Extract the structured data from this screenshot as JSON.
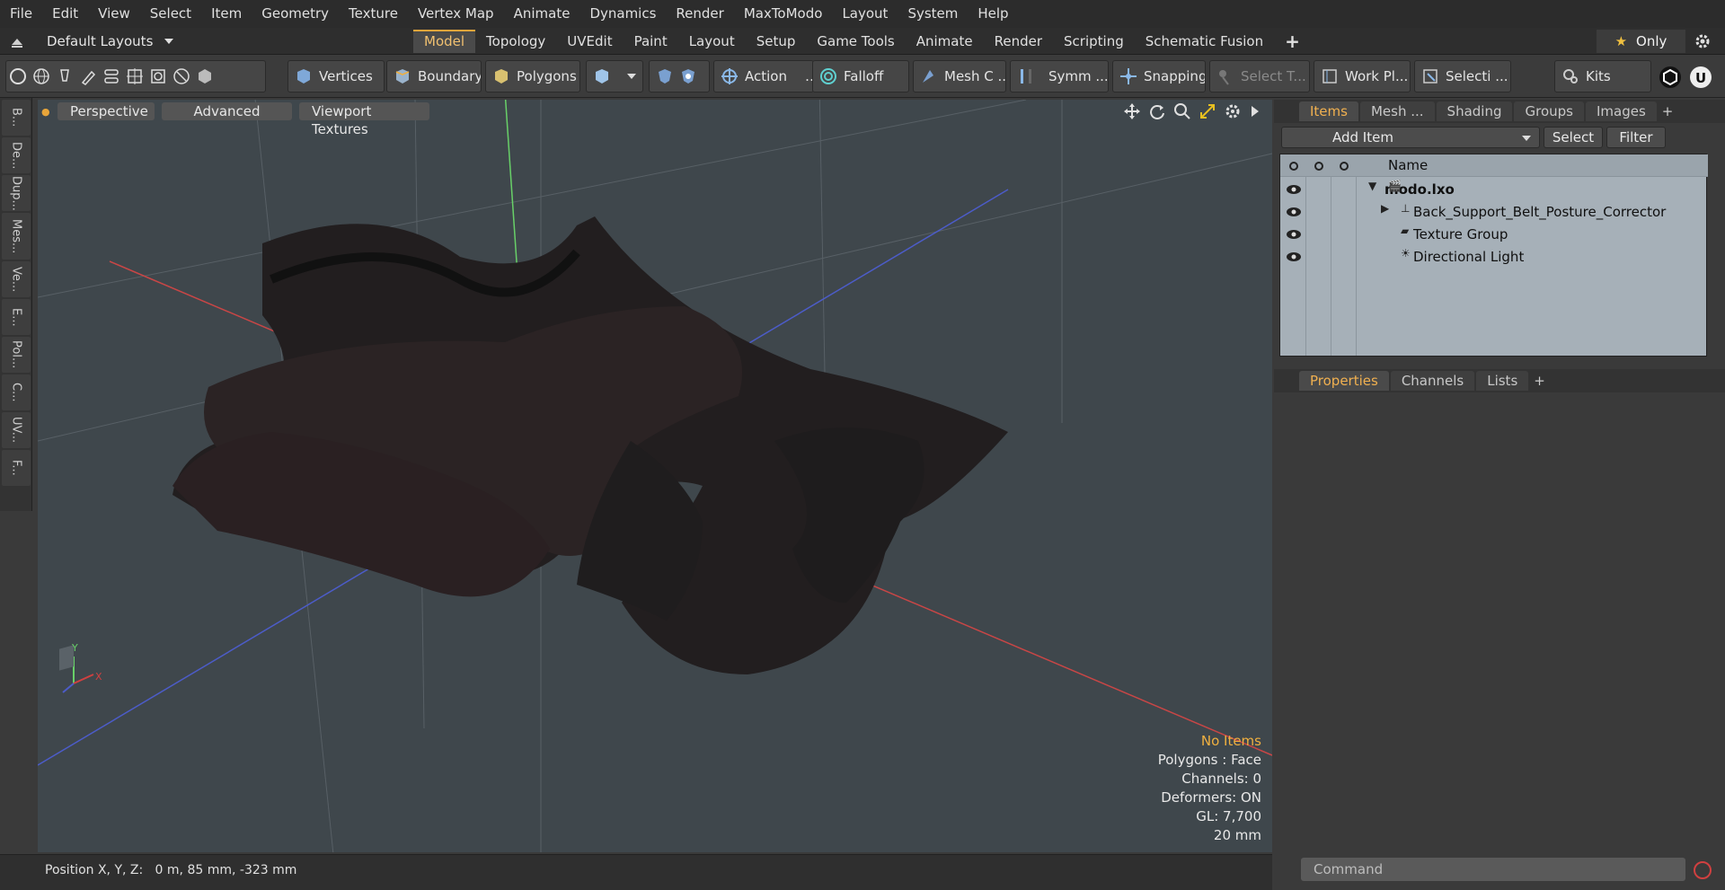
{
  "menu": [
    "File",
    "Edit",
    "View",
    "Select",
    "Item",
    "Geometry",
    "Texture",
    "Vertex Map",
    "Animate",
    "Dynamics",
    "Render",
    "MaxToModo",
    "Layout",
    "System",
    "Help"
  ],
  "layouts": {
    "label": "Default Layouts"
  },
  "tabs": [
    "Model",
    "Topology",
    "UVEdit",
    "Paint",
    "Layout",
    "Setup",
    "Game Tools",
    "Animate",
    "Render",
    "Scripting",
    "Schematic Fusion"
  ],
  "active_tab": "Model",
  "only": "Only",
  "toolbar": {
    "vertices": "Vertices",
    "boundary": "Boundary",
    "polygons": "Polygons",
    "action": "Action",
    "action_more": "…",
    "falloff": "Falloff",
    "mesh": "Mesh C ...",
    "symm": "Symm ...",
    "snapping": "Snapping",
    "select_t": "Select T...",
    "workplane": "Work Pl...",
    "selection": "Selecti ...",
    "kits": "Kits"
  },
  "left_tabs": [
    "B...",
    "De...",
    "Dup...",
    "Mes...",
    "Ve...",
    "E...",
    "Pol...",
    "C...",
    "UV...",
    "F..."
  ],
  "viewport": {
    "tabs": [
      "Perspective",
      "Advanced",
      "Viewport Textures"
    ],
    "info": {
      "no_items": "No Items",
      "polygons": "Polygons : Face",
      "channels": "Channels: 0",
      "deformers": "Deformers: ON",
      "gl": "GL: 7,700",
      "scale": "20 mm"
    },
    "axis": {
      "y": "Y",
      "x": "X"
    }
  },
  "status": {
    "position": "Position X, Y, Z:   0 m, 85 mm, -323 mm"
  },
  "items_panel": {
    "tabs": [
      "Items",
      "Mesh ...",
      "Shading",
      "Groups",
      "Images"
    ],
    "add_item": "Add Item",
    "select": "Select",
    "filter": "Filter",
    "name_col": "Name",
    "rows": [
      {
        "label": "modo.lxo"
      },
      {
        "label": "Back_Support_Belt_Posture_Corrector"
      },
      {
        "label": "Texture Group"
      },
      {
        "label": "Directional Light"
      }
    ]
  },
  "props_panel": {
    "tabs": [
      "Properties",
      "Channels",
      "Lists"
    ]
  },
  "command": {
    "placeholder": "Command"
  },
  "colors": {
    "accent": "#e8a53a",
    "viewport_bg": "#3f474c",
    "tree_bg": "#a6b0b8"
  }
}
